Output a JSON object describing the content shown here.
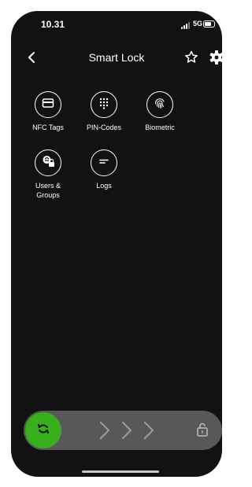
{
  "status_bar": {
    "time": "10.31",
    "network": "5G"
  },
  "header": {
    "title": "Smart Lock"
  },
  "tiles": [
    {
      "label": "NFC Tags"
    },
    {
      "label": "PIN-Codes"
    },
    {
      "label": "Biometric"
    },
    {
      "label": "Users &\nGroups"
    },
    {
      "label": "Logs"
    }
  ],
  "slider": {
    "action": "unlock",
    "knob_color": "#38b01c",
    "track_color": "#585858"
  },
  "icons": [
    "back-icon",
    "star-icon",
    "gear-icon",
    "nfc-card-icon",
    "keypad-icon",
    "fingerprint-icon",
    "users-groups-icon",
    "logs-icon",
    "lock-icon",
    "chevron-right-icon"
  ]
}
